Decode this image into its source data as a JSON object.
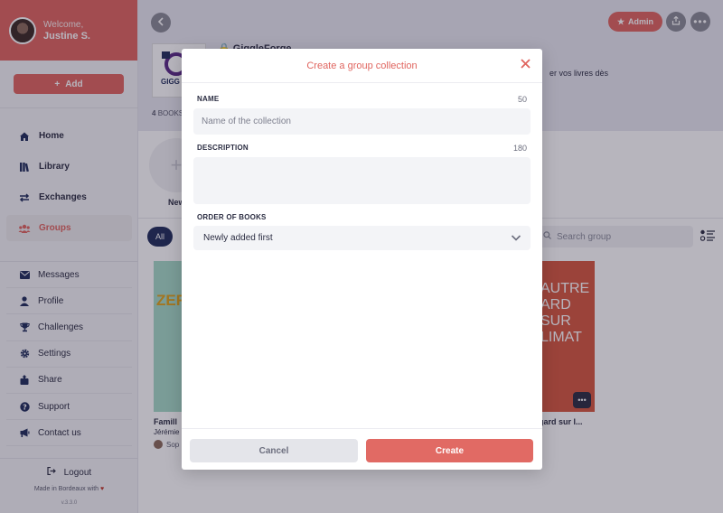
{
  "sidebar": {
    "welcome": "Welcome,",
    "user_name": "Justine S.",
    "add_label": "Add",
    "nav_main": [
      {
        "label": "Home",
        "icon": "home-icon"
      },
      {
        "label": "Library",
        "icon": "library-icon"
      },
      {
        "label": "Exchanges",
        "icon": "exchange-icon"
      },
      {
        "label": "Groups",
        "icon": "groups-icon",
        "active": true
      }
    ],
    "nav_secondary": [
      {
        "label": "Messages",
        "icon": "mail-icon"
      },
      {
        "label": "Profile",
        "icon": "user-icon"
      },
      {
        "label": "Challenges",
        "icon": "trophy-icon"
      },
      {
        "label": "Settings",
        "icon": "gear-icon"
      },
      {
        "label": "Share",
        "icon": "share-icon"
      },
      {
        "label": "Support",
        "icon": "help-icon"
      },
      {
        "label": "Contact us",
        "icon": "megaphone-icon"
      }
    ],
    "logout": "Logout",
    "made_in": "Made in Bordeaux with",
    "version": "v.3.3.0"
  },
  "header": {
    "admin_label": "Admin",
    "group_name": "GiggleForge",
    "logo_text": "GIGG FOR",
    "description_fragment": "er vos livres dès",
    "books_count": "4",
    "books_label": "BOOKS"
  },
  "content": {
    "new_label": "New",
    "filter_all": "All",
    "search_placeholder": "Search group",
    "book1": {
      "cover_text": "ZER",
      "title": "Famill",
      "author": "Jérémie",
      "owner": "Sop"
    },
    "book2": {
      "cover_text": "AUTRE ARD SUR LIMAT",
      "title": "gard sur l..."
    }
  },
  "modal": {
    "title": "Create a group collection",
    "name_label": "NAME",
    "name_max": "50",
    "name_placeholder": "Name of the collection",
    "name_value": "",
    "description_label": "DESCRIPTION",
    "description_max": "180",
    "description_value": "",
    "order_label": "ORDER OF BOOKS",
    "order_selected": "Newly added first",
    "cancel_label": "Cancel",
    "create_label": "Create"
  },
  "colors": {
    "accent": "#e0655f",
    "navy": "#1f2d5a"
  }
}
